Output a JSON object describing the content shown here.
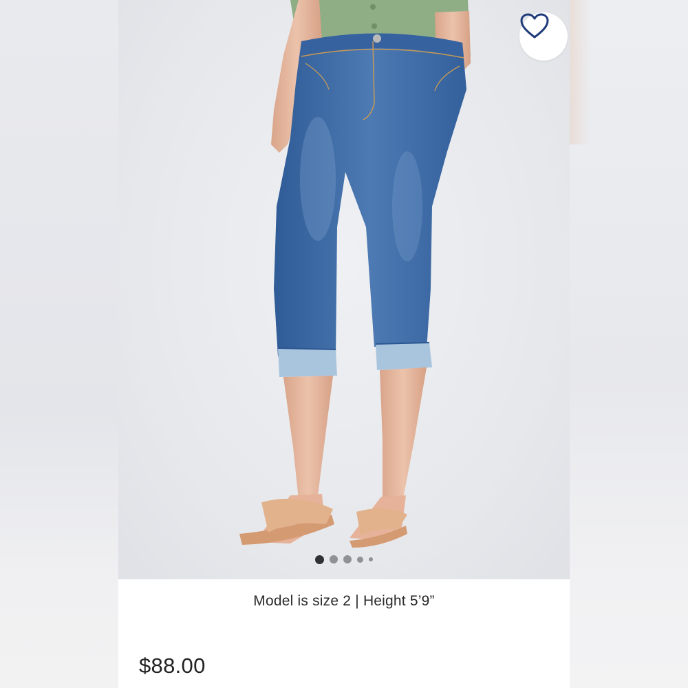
{
  "product": {
    "model_info": {
      "prefix": "Model is size",
      "size": "2",
      "separator": "|",
      "height_label": "Height",
      "height_value": "5’9”"
    },
    "price": "$88.00"
  },
  "gallery": {
    "slide_count": 5,
    "active_slide": 1
  },
  "favorite": {
    "icon": "heart-outline-icon",
    "color": "#1f3a7a",
    "active": false
  },
  "colors": {
    "denim": "#3c67a3",
    "cuff": "#a9c5de",
    "sandal": "#e2b28c",
    "shirt": "#8fae86",
    "skin": "#e7b9a0"
  }
}
